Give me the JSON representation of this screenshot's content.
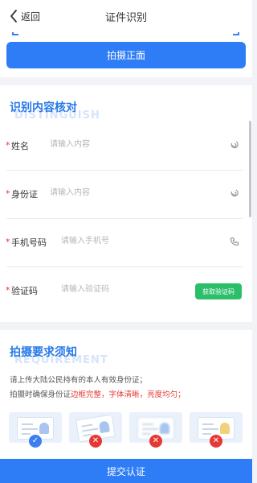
{
  "header": {
    "back_label": "返回",
    "title": "证件识别"
  },
  "capture": {
    "front_button": "拍摄正面"
  },
  "verify": {
    "title": "识别内容核对",
    "watermark": "DISTINGUISH",
    "fields": [
      {
        "label": "姓名",
        "placeholder": "请输入内容",
        "value": "",
        "icon": "voice-icon",
        "required": "*"
      },
      {
        "label": "身份证",
        "placeholder": "请输入内容",
        "value": "",
        "icon": "voice-icon",
        "required": "*"
      },
      {
        "label": "手机号码",
        "placeholder": "请输入手机号",
        "value": "",
        "icon": "phone-icon",
        "required": "*"
      },
      {
        "label": "验证码",
        "placeholder": "请输入验证码",
        "value": "",
        "required": "*"
      }
    ],
    "sms_button": "获取验证码"
  },
  "requirements": {
    "title": "拍摄要求须知",
    "watermark": "REQUIREMENT",
    "line1": "请上传大陆公民持有的本人有效身份证；",
    "line2_prefix": "拍摄时确保身份证",
    "line2_border": "边框完整",
    "line2_sep1": "，",
    "line2_font": "字体清晰",
    "line2_sep2": "，",
    "line2_light": "亮度均匀",
    "line2_end": "；",
    "samples": [
      {
        "status": "ok",
        "mark": "✓",
        "color": "#3d7ef0"
      },
      {
        "status": "bad",
        "mark": "✕",
        "color": "#e53935"
      },
      {
        "status": "bad",
        "mark": "✕",
        "color": "#e53935"
      },
      {
        "status": "bad",
        "mark": "✕",
        "color": "#e53935"
      }
    ]
  },
  "footer": {
    "submit_label": "提交认证"
  },
  "colors": {
    "primary": "#2f7df6",
    "success": "#2cbf6a",
    "danger": "#e53935",
    "title_blue": "#2878e8"
  }
}
